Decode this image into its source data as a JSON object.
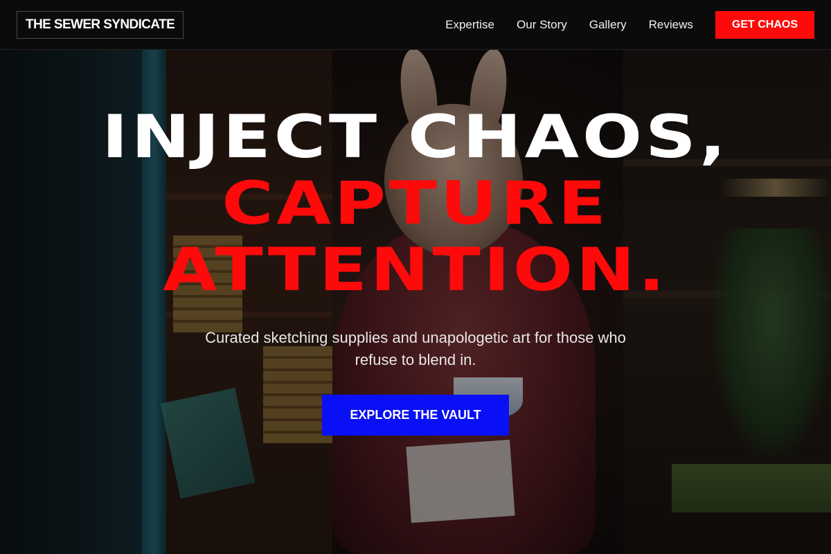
{
  "brand": {
    "name": "THE SEWER SYNDICATE"
  },
  "nav": {
    "items": [
      {
        "label": "Expertise"
      },
      {
        "label": "Our Story"
      },
      {
        "label": "Gallery"
      },
      {
        "label": "Reviews"
      }
    ],
    "cta_label": "GET CHAOS"
  },
  "hero": {
    "line1": "INJECT CHAOS,",
    "line2": "CAPTURE",
    "line3": "ATTENTION.",
    "subtitle": "Curated sketching supplies and unapologetic art for those who refuse to blend in.",
    "cta_label": "EXPLORE THE VAULT"
  },
  "colors": {
    "accent_red": "#ff0a0a",
    "accent_blue": "#0a10f5",
    "header_bg": "#0b0b0b",
    "text": "#ffffff"
  }
}
